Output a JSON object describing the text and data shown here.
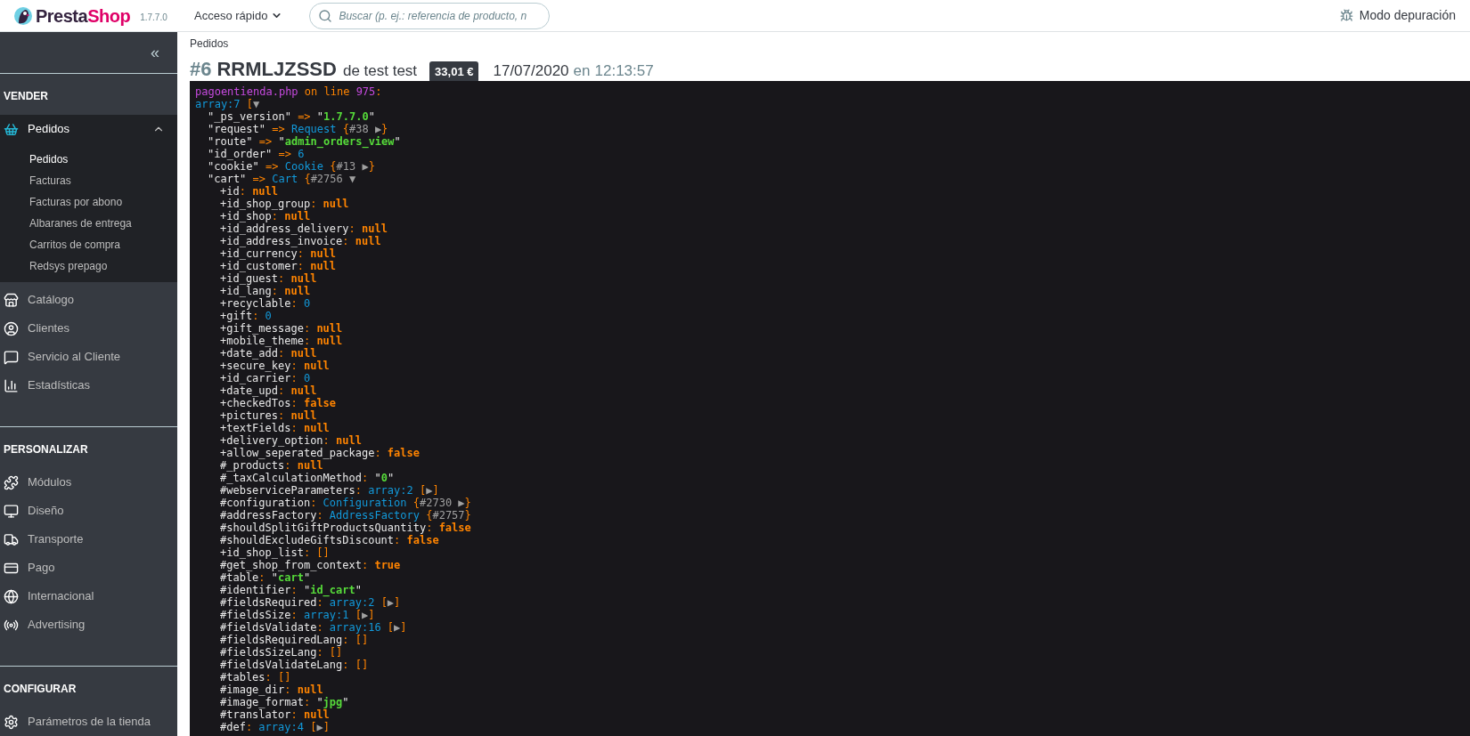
{
  "header": {
    "logo": {
      "first": "Presta",
      "second": "Shop"
    },
    "version": "1.7.7.0",
    "quick_access": "Acceso rápido",
    "search": {
      "placeholder": "Buscar (p. ej.: referencia de producto, n"
    },
    "debug": "Modo depuración"
  },
  "sidebar": {
    "collapse": "«",
    "sections": [
      {
        "title": "VENDER",
        "items": [
          {
            "label": "Pedidos",
            "selected": true,
            "expanded": true,
            "children": [
              {
                "label": "Pedidos",
                "selected": true
              },
              {
                "label": "Facturas",
                "selected": false
              },
              {
                "label": "Facturas por abono",
                "selected": false
              },
              {
                "label": "Albaranes de entrega",
                "selected": false
              },
              {
                "label": "Carritos de compra",
                "selected": false
              },
              {
                "label": "Redsys prepago",
                "selected": false
              }
            ]
          },
          {
            "label": "Catálogo",
            "selected": false
          },
          {
            "label": "Clientes",
            "selected": false
          },
          {
            "label": "Servicio al Cliente",
            "selected": false
          },
          {
            "label": "Estadísticas",
            "selected": false
          }
        ]
      },
      {
        "title": "PERSONALIZAR",
        "items": [
          {
            "label": "Módulos",
            "selected": false
          },
          {
            "label": "Diseño",
            "selected": false
          },
          {
            "label": "Transporte",
            "selected": false
          },
          {
            "label": "Pago",
            "selected": false
          },
          {
            "label": "Internacional",
            "selected": false
          },
          {
            "label": "Advertising",
            "selected": false
          }
        ]
      },
      {
        "title": "CONFIGURAR",
        "items": [
          {
            "label": "Parámetros de la tienda",
            "selected": false
          }
        ]
      }
    ]
  },
  "breadcrumb": "Pedidos",
  "title": {
    "number": "#6",
    "reference": "RRMLJZSSD",
    "customer": "de test test",
    "total": "33,01 €",
    "date": "17/07/2020",
    "at": "en",
    "time": "12:13:57"
  },
  "dump": {
    "lines": [
      {
        "parts": [
          {
            "kind": "file",
            "text": "pagoentienda.php"
          },
          {
            "kind": "meta",
            "text": " on line "
          },
          {
            "kind": "file",
            "text": "975"
          },
          {
            "kind": "meta",
            "text": ":"
          }
        ]
      },
      {
        "parts": [
          {
            "kind": "type",
            "text": "array:7"
          },
          {
            "kind": "meta",
            "text": " ["
          },
          {
            "kind": "toggle",
            "text": "▼"
          }
        ],
        "children": [
          {
            "parts": [
              {
                "kind": "key",
                "text": "\"_ps_version\""
              },
              {
                "kind": "meta",
                "text": " => "
              },
              {
                "kind": "key",
                "text": "\""
              },
              {
                "kind": "string",
                "text": "1.7.7.0"
              },
              {
                "kind": "key",
                "text": "\""
              }
            ]
          },
          {
            "parts": [
              {
                "kind": "key",
                "text": "\"request\""
              },
              {
                "kind": "meta",
                "text": " => "
              },
              {
                "kind": "type",
                "text": "Request"
              },
              {
                "kind": "meta",
                "text": " {"
              },
              {
                "kind": "ref",
                "text": "#38"
              },
              {
                "kind": "toggle",
                "text": " ▶"
              },
              {
                "kind": "meta",
                "text": "}"
              }
            ]
          },
          {
            "parts": [
              {
                "kind": "key",
                "text": "\"route\""
              },
              {
                "kind": "meta",
                "text": " => "
              },
              {
                "kind": "key",
                "text": "\""
              },
              {
                "kind": "string",
                "text": "admin_orders_view"
              },
              {
                "kind": "key",
                "text": "\""
              }
            ]
          },
          {
            "parts": [
              {
                "kind": "key",
                "text": "\"id_order\""
              },
              {
                "kind": "meta",
                "text": " => "
              },
              {
                "kind": "number",
                "text": "6"
              }
            ]
          },
          {
            "parts": [
              {
                "kind": "key",
                "text": "\"cookie\""
              },
              {
                "kind": "meta",
                "text": " => "
              },
              {
                "kind": "type",
                "text": "Cookie"
              },
              {
                "kind": "meta",
                "text": " {"
              },
              {
                "kind": "ref",
                "text": "#13"
              },
              {
                "kind": "toggle",
                "text": " ▶"
              },
              {
                "kind": "meta",
                "text": "}"
              }
            ]
          },
          {
            "parts": [
              {
                "kind": "key",
                "text": "\"cart\""
              },
              {
                "kind": "meta",
                "text": " => "
              },
              {
                "kind": "type",
                "text": "Cart"
              },
              {
                "kind": "meta",
                "text": " {"
              },
              {
                "kind": "ref",
                "text": "#2756"
              },
              {
                "kind": "toggle",
                "text": " ▼"
              }
            ],
            "children": [
              {
                "parts": [
                  {
                    "kind": "key",
                    "text": "+id"
                  },
                  {
                    "kind": "meta",
                    "text": ": "
                  },
                  {
                    "kind": "const",
                    "text": "null"
                  }
                ]
              },
              {
                "parts": [
                  {
                    "kind": "key",
                    "text": "+id_shop_group"
                  },
                  {
                    "kind": "meta",
                    "text": ": "
                  },
                  {
                    "kind": "const",
                    "text": "null"
                  }
                ]
              },
              {
                "parts": [
                  {
                    "kind": "key",
                    "text": "+id_shop"
                  },
                  {
                    "kind": "meta",
                    "text": ": "
                  },
                  {
                    "kind": "const",
                    "text": "null"
                  }
                ]
              },
              {
                "parts": [
                  {
                    "kind": "key",
                    "text": "+id_address_delivery"
                  },
                  {
                    "kind": "meta",
                    "text": ": "
                  },
                  {
                    "kind": "const",
                    "text": "null"
                  }
                ]
              },
              {
                "parts": [
                  {
                    "kind": "key",
                    "text": "+id_address_invoice"
                  },
                  {
                    "kind": "meta",
                    "text": ": "
                  },
                  {
                    "kind": "const",
                    "text": "null"
                  }
                ]
              },
              {
                "parts": [
                  {
                    "kind": "key",
                    "text": "+id_currency"
                  },
                  {
                    "kind": "meta",
                    "text": ": "
                  },
                  {
                    "kind": "const",
                    "text": "null"
                  }
                ]
              },
              {
                "parts": [
                  {
                    "kind": "key",
                    "text": "+id_customer"
                  },
                  {
                    "kind": "meta",
                    "text": ": "
                  },
                  {
                    "kind": "const",
                    "text": "null"
                  }
                ]
              },
              {
                "parts": [
                  {
                    "kind": "key",
                    "text": "+id_guest"
                  },
                  {
                    "kind": "meta",
                    "text": ": "
                  },
                  {
                    "kind": "const",
                    "text": "null"
                  }
                ]
              },
              {
                "parts": [
                  {
                    "kind": "key",
                    "text": "+id_lang"
                  },
                  {
                    "kind": "meta",
                    "text": ": "
                  },
                  {
                    "kind": "const",
                    "text": "null"
                  }
                ]
              },
              {
                "parts": [
                  {
                    "kind": "key",
                    "text": "+recyclable"
                  },
                  {
                    "kind": "meta",
                    "text": ": "
                  },
                  {
                    "kind": "number",
                    "text": "0"
                  }
                ]
              },
              {
                "parts": [
                  {
                    "kind": "key",
                    "text": "+gift"
                  },
                  {
                    "kind": "meta",
                    "text": ": "
                  },
                  {
                    "kind": "number",
                    "text": "0"
                  }
                ]
              },
              {
                "parts": [
                  {
                    "kind": "key",
                    "text": "+gift_message"
                  },
                  {
                    "kind": "meta",
                    "text": ": "
                  },
                  {
                    "kind": "const",
                    "text": "null"
                  }
                ]
              },
              {
                "parts": [
                  {
                    "kind": "key",
                    "text": "+mobile_theme"
                  },
                  {
                    "kind": "meta",
                    "text": ": "
                  },
                  {
                    "kind": "const",
                    "text": "null"
                  }
                ]
              },
              {
                "parts": [
                  {
                    "kind": "key",
                    "text": "+date_add"
                  },
                  {
                    "kind": "meta",
                    "text": ": "
                  },
                  {
                    "kind": "const",
                    "text": "null"
                  }
                ]
              },
              {
                "parts": [
                  {
                    "kind": "key",
                    "text": "+secure_key"
                  },
                  {
                    "kind": "meta",
                    "text": ": "
                  },
                  {
                    "kind": "const",
                    "text": "null"
                  }
                ]
              },
              {
                "parts": [
                  {
                    "kind": "key",
                    "text": "+id_carrier"
                  },
                  {
                    "kind": "meta",
                    "text": ": "
                  },
                  {
                    "kind": "number",
                    "text": "0"
                  }
                ]
              },
              {
                "parts": [
                  {
                    "kind": "key",
                    "text": "+date_upd"
                  },
                  {
                    "kind": "meta",
                    "text": ": "
                  },
                  {
                    "kind": "const",
                    "text": "null"
                  }
                ]
              },
              {
                "parts": [
                  {
                    "kind": "key",
                    "text": "+checkedTos"
                  },
                  {
                    "kind": "meta",
                    "text": ": "
                  },
                  {
                    "kind": "const",
                    "text": "false"
                  }
                ]
              },
              {
                "parts": [
                  {
                    "kind": "key",
                    "text": "+pictures"
                  },
                  {
                    "kind": "meta",
                    "text": ": "
                  },
                  {
                    "kind": "const",
                    "text": "null"
                  }
                ]
              },
              {
                "parts": [
                  {
                    "kind": "key",
                    "text": "+textFields"
                  },
                  {
                    "kind": "meta",
                    "text": ": "
                  },
                  {
                    "kind": "const",
                    "text": "null"
                  }
                ]
              },
              {
                "parts": [
                  {
                    "kind": "key",
                    "text": "+delivery_option"
                  },
                  {
                    "kind": "meta",
                    "text": ": "
                  },
                  {
                    "kind": "const",
                    "text": "null"
                  }
                ]
              },
              {
                "parts": [
                  {
                    "kind": "key",
                    "text": "+allow_seperated_package"
                  },
                  {
                    "kind": "meta",
                    "text": ": "
                  },
                  {
                    "kind": "const",
                    "text": "false"
                  }
                ]
              },
              {
                "parts": [
                  {
                    "kind": "key",
                    "text": "#_products"
                  },
                  {
                    "kind": "meta",
                    "text": ": "
                  },
                  {
                    "kind": "const",
                    "text": "null"
                  }
                ]
              },
              {
                "parts": [
                  {
                    "kind": "key",
                    "text": "#_taxCalculationMethod"
                  },
                  {
                    "kind": "meta",
                    "text": ": "
                  },
                  {
                    "kind": "key",
                    "text": "\""
                  },
                  {
                    "kind": "string",
                    "text": "0"
                  },
                  {
                    "kind": "key",
                    "text": "\""
                  }
                ]
              },
              {
                "parts": [
                  {
                    "kind": "key",
                    "text": "#webserviceParameters"
                  },
                  {
                    "kind": "meta",
                    "text": ": "
                  },
                  {
                    "kind": "type",
                    "text": "array:2"
                  },
                  {
                    "kind": "meta",
                    "text": " ["
                  },
                  {
                    "kind": "toggle",
                    "text": "▶"
                  },
                  {
                    "kind": "meta",
                    "text": "]"
                  }
                ]
              },
              {
                "parts": [
                  {
                    "kind": "key",
                    "text": "#configuration"
                  },
                  {
                    "kind": "meta",
                    "text": ": "
                  },
                  {
                    "kind": "type",
                    "text": "Configuration"
                  },
                  {
                    "kind": "meta",
                    "text": " {"
                  },
                  {
                    "kind": "ref",
                    "text": "#2730"
                  },
                  {
                    "kind": "toggle",
                    "text": " ▶"
                  },
                  {
                    "kind": "meta",
                    "text": "}"
                  }
                ]
              },
              {
                "parts": [
                  {
                    "kind": "key",
                    "text": "#addressFactory"
                  },
                  {
                    "kind": "meta",
                    "text": ": "
                  },
                  {
                    "kind": "type",
                    "text": "AddressFactory"
                  },
                  {
                    "kind": "meta",
                    "text": " {"
                  },
                  {
                    "kind": "ref",
                    "text": "#2757"
                  },
                  {
                    "kind": "meta",
                    "text": "}"
                  }
                ]
              },
              {
                "parts": [
                  {
                    "kind": "key",
                    "text": "#shouldSplitGiftProductsQuantity"
                  },
                  {
                    "kind": "meta",
                    "text": ": "
                  },
                  {
                    "kind": "const",
                    "text": "false"
                  }
                ]
              },
              {
                "parts": [
                  {
                    "kind": "key",
                    "text": "#shouldExcludeGiftsDiscount"
                  },
                  {
                    "kind": "meta",
                    "text": ": "
                  },
                  {
                    "kind": "const",
                    "text": "false"
                  }
                ]
              },
              {
                "parts": [
                  {
                    "kind": "key",
                    "text": "+id_shop_list"
                  },
                  {
                    "kind": "meta",
                    "text": ": []"
                  }
                ]
              },
              {
                "parts": [
                  {
                    "kind": "key",
                    "text": "#get_shop_from_context"
                  },
                  {
                    "kind": "meta",
                    "text": ": "
                  },
                  {
                    "kind": "const",
                    "text": "true"
                  }
                ]
              },
              {
                "parts": [
                  {
                    "kind": "key",
                    "text": "#table"
                  },
                  {
                    "kind": "meta",
                    "text": ": "
                  },
                  {
                    "kind": "key",
                    "text": "\""
                  },
                  {
                    "kind": "string",
                    "text": "cart"
                  },
                  {
                    "kind": "key",
                    "text": "\""
                  }
                ]
              },
              {
                "parts": [
                  {
                    "kind": "key",
                    "text": "#identifier"
                  },
                  {
                    "kind": "meta",
                    "text": ": "
                  },
                  {
                    "kind": "key",
                    "text": "\""
                  },
                  {
                    "kind": "string",
                    "text": "id_cart"
                  },
                  {
                    "kind": "key",
                    "text": "\""
                  }
                ]
              },
              {
                "parts": [
                  {
                    "kind": "key",
                    "text": "#fieldsRequired"
                  },
                  {
                    "kind": "meta",
                    "text": ": "
                  },
                  {
                    "kind": "type",
                    "text": "array:2"
                  },
                  {
                    "kind": "meta",
                    "text": " ["
                  },
                  {
                    "kind": "toggle",
                    "text": "▶"
                  },
                  {
                    "kind": "meta",
                    "text": "]"
                  }
                ]
              },
              {
                "parts": [
                  {
                    "kind": "key",
                    "text": "#fieldsSize"
                  },
                  {
                    "kind": "meta",
                    "text": ": "
                  },
                  {
                    "kind": "type",
                    "text": "array:1"
                  },
                  {
                    "kind": "meta",
                    "text": " ["
                  },
                  {
                    "kind": "toggle",
                    "text": "▶"
                  },
                  {
                    "kind": "meta",
                    "text": "]"
                  }
                ]
              },
              {
                "parts": [
                  {
                    "kind": "key",
                    "text": "#fieldsValidate"
                  },
                  {
                    "kind": "meta",
                    "text": ": "
                  },
                  {
                    "kind": "type",
                    "text": "array:16"
                  },
                  {
                    "kind": "meta",
                    "text": " ["
                  },
                  {
                    "kind": "toggle",
                    "text": "▶"
                  },
                  {
                    "kind": "meta",
                    "text": "]"
                  }
                ]
              },
              {
                "parts": [
                  {
                    "kind": "key",
                    "text": "#fieldsRequiredLang"
                  },
                  {
                    "kind": "meta",
                    "text": ": []"
                  }
                ]
              },
              {
                "parts": [
                  {
                    "kind": "key",
                    "text": "#fieldsSizeLang"
                  },
                  {
                    "kind": "meta",
                    "text": ": []"
                  }
                ]
              },
              {
                "parts": [
                  {
                    "kind": "key",
                    "text": "#fieldsValidateLang"
                  },
                  {
                    "kind": "meta",
                    "text": ": []"
                  }
                ]
              },
              {
                "parts": [
                  {
                    "kind": "key",
                    "text": "#tables"
                  },
                  {
                    "kind": "meta",
                    "text": ": []"
                  }
                ]
              },
              {
                "parts": [
                  {
                    "kind": "key",
                    "text": "#image_dir"
                  },
                  {
                    "kind": "meta",
                    "text": ": "
                  },
                  {
                    "kind": "const",
                    "text": "null"
                  }
                ]
              },
              {
                "parts": [
                  {
                    "kind": "key",
                    "text": "#image_format"
                  },
                  {
                    "kind": "meta",
                    "text": ": "
                  },
                  {
                    "kind": "key",
                    "text": "\""
                  },
                  {
                    "kind": "string",
                    "text": "jpg"
                  },
                  {
                    "kind": "key",
                    "text": "\""
                  }
                ]
              },
              {
                "parts": [
                  {
                    "kind": "key",
                    "text": "#translator"
                  },
                  {
                    "kind": "meta",
                    "text": ": "
                  },
                  {
                    "kind": "const",
                    "text": "null"
                  }
                ]
              },
              {
                "parts": [
                  {
                    "kind": "key",
                    "text": "#def"
                  },
                  {
                    "kind": "meta",
                    "text": ": "
                  },
                  {
                    "kind": "type",
                    "text": "array:4"
                  },
                  {
                    "kind": "meta",
                    "text": " ["
                  },
                  {
                    "kind": "toggle",
                    "text": "▶"
                  },
                  {
                    "kind": "meta",
                    "text": "]"
                  }
                ]
              }
            ]
          }
        ]
      }
    ]
  }
}
